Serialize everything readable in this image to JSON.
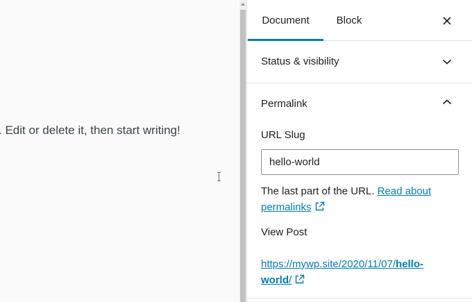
{
  "editor": {
    "paragraph_text": ". Edit or delete it, then start writing!"
  },
  "sidebar": {
    "tabs": [
      {
        "label": "Document",
        "active": true
      },
      {
        "label": "Block",
        "active": false
      }
    ],
    "close_icon": "close-icon",
    "panels": {
      "status_visibility": {
        "title": "Status & visibility",
        "expanded": false
      },
      "permalink": {
        "title": "Permalink",
        "expanded": true,
        "url_slug_label": "URL Slug",
        "url_slug_value": "hello-world",
        "help_text": "The last part of the URL.",
        "help_link_text_1": "Read about",
        "help_link_text_2": "permalinks",
        "view_post_label": "View Post",
        "post_url_base": "https://mywp.site/2020/11/07/",
        "post_url_slug_1": "hello-",
        "post_url_slug_2": "world",
        "post_url_trailing": "/"
      }
    }
  },
  "colors": {
    "accent": "#007cba",
    "text": "#1e1e1e",
    "border": "#e0e0e0"
  }
}
